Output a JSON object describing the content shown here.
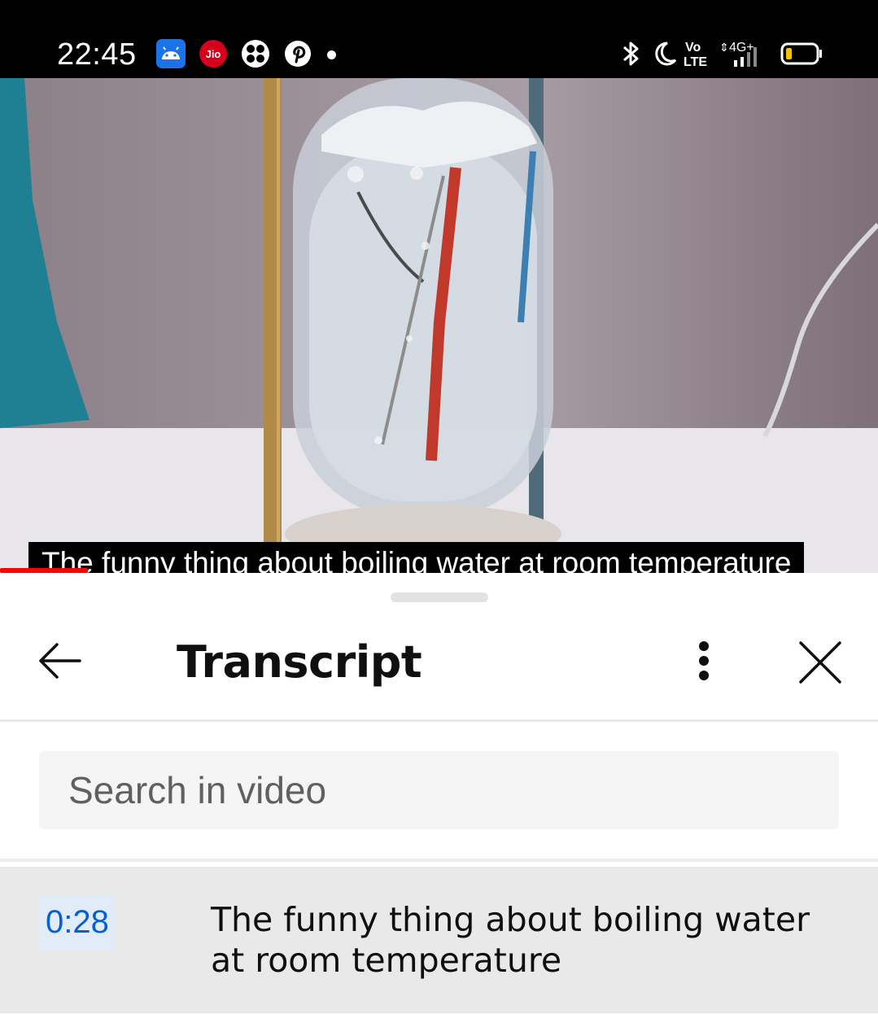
{
  "status_bar": {
    "time": "22:45",
    "notification_icons": [
      "android-icon",
      "jio-icon",
      "fan-icon",
      "pinterest-icon",
      "dot-icon"
    ],
    "jio_label": "Jio",
    "right_icons": [
      "bluetooth-icon",
      "do-not-disturb-moon-icon",
      "volte-icon",
      "4g-signal-icon",
      "battery-icon"
    ],
    "volte_label_top": "Vo",
    "volte_label_bottom": "LTE",
    "network_label": "4G+"
  },
  "video": {
    "caption": "The funny thing about boiling water at room temperature",
    "progress_fraction": 0.1
  },
  "transcript_panel": {
    "title": "Transcript",
    "search": {
      "placeholder": "Search in video",
      "value": ""
    },
    "segments": [
      {
        "timestamp": "0:28",
        "text": "The funny thing about boiling water at room temperature"
      }
    ]
  },
  "colors": {
    "accent_red": "#ff0000",
    "timestamp_blue": "#065fd4",
    "timestamp_bg": "#e1ecf8",
    "active_row_bg": "#e9e9e9"
  }
}
